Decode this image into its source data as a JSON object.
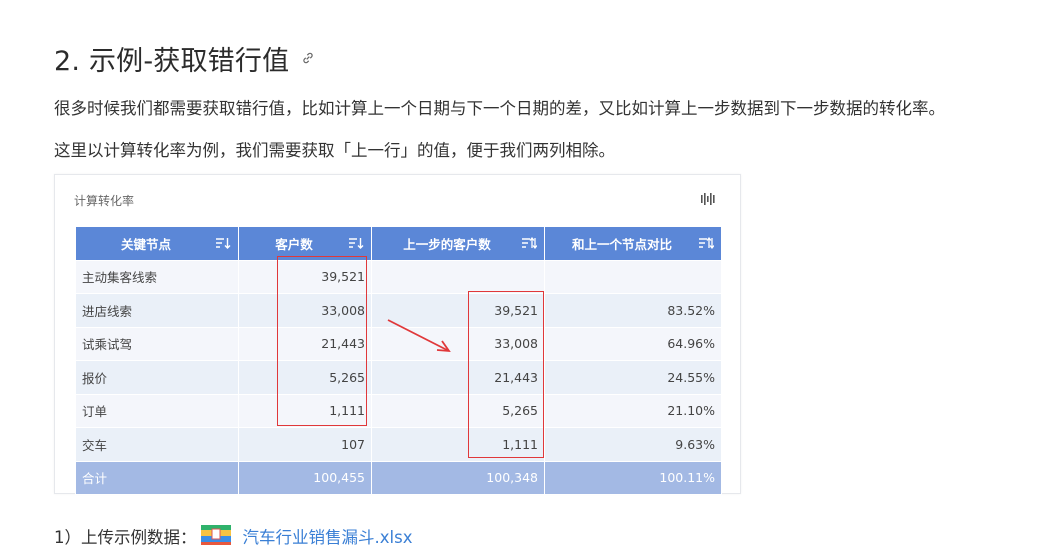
{
  "section": {
    "heading": "2. 示例-获取错行值",
    "paragraph1": "很多时候我们都需要获取错行值，比如计算上一个日期与下一个日期的差，又比如计算上一步数据到下一步数据的转化率。",
    "paragraph2": "这里以计算转化率为例，我们需要获取「上一行」的值，便于我们两列相除。"
  },
  "card": {
    "title": "计算转化率",
    "columns": [
      "关键节点",
      "客户数",
      "上一步的客户数",
      "和上一个节点对比"
    ],
    "rows": [
      [
        "主动集客线索",
        "39,521",
        "",
        ""
      ],
      [
        "进店线索",
        "33,008",
        "39,521",
        "83.52%"
      ],
      [
        "试乘试驾",
        "21,443",
        "33,008",
        "64.96%"
      ],
      [
        "报价",
        "5,265",
        "21,443",
        "24.55%"
      ],
      [
        "订单",
        "1,111",
        "5,265",
        "21.10%"
      ],
      [
        "交车",
        "107",
        "1,111",
        "9.63%"
      ]
    ],
    "total": [
      "合计",
      "100,455",
      "100,348",
      "100.11%"
    ]
  },
  "upload": {
    "label": "1）上传示例数据：",
    "file_name": "汽车行业销售漏斗.xlsx"
  },
  "colors": {
    "header": "#5b87d7",
    "total": "#a3b9e4",
    "highlight": "#e0383a",
    "link": "#3a7fd5"
  },
  "icons": [
    "link-icon",
    "chart-settings-icon",
    "sort-icon",
    "file-archive-icon"
  ]
}
